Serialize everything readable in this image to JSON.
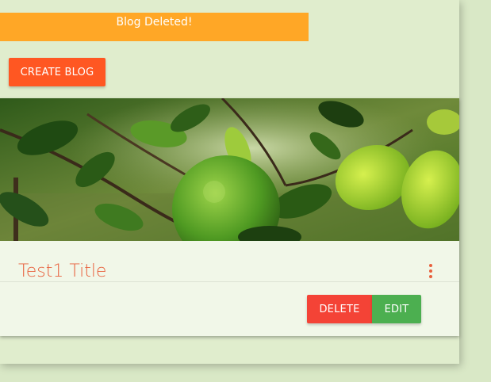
{
  "toast": {
    "message": "Blog Deleted!"
  },
  "toolbar": {
    "create_label": "CREATE BLOG"
  },
  "card": {
    "title": "Test1 Title",
    "image_alt": "green lime fruit on a tree branch",
    "actions": {
      "delete_label": "DELETE",
      "edit_label": "EDIT"
    },
    "menu_icon": "more-vert-icon"
  },
  "colors": {
    "page_bg": "#d9e8c6",
    "toast": "#ffa726",
    "primary": "#ff5722",
    "danger": "#f44336",
    "success": "#4caf50",
    "title": "#e8603c"
  }
}
